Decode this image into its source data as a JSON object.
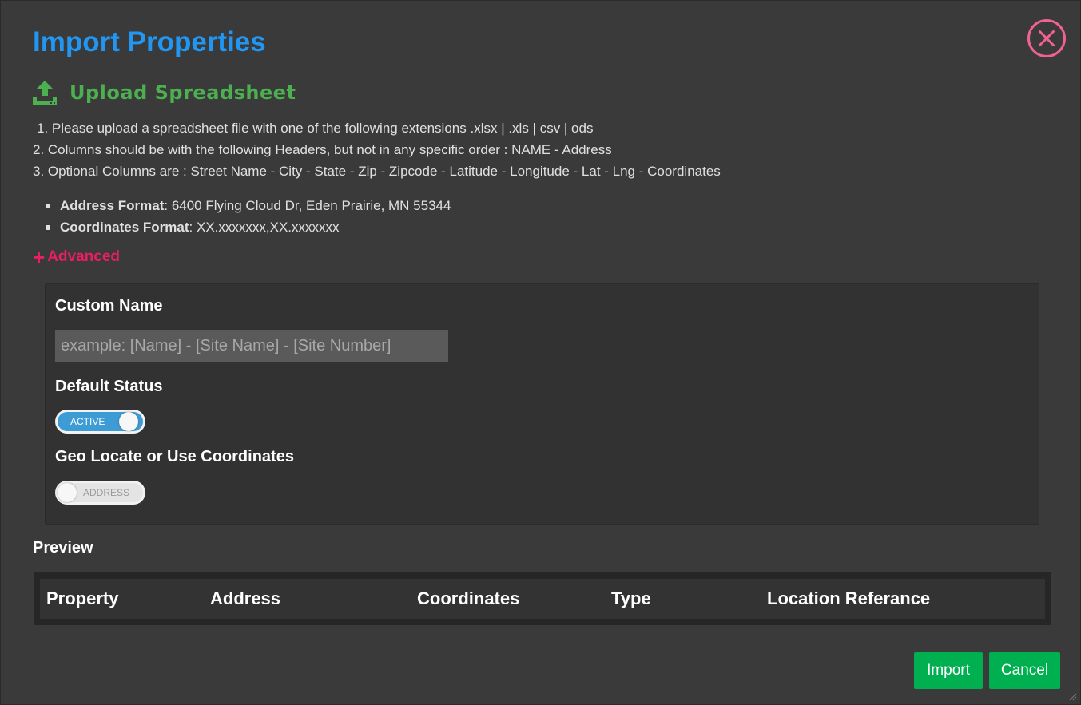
{
  "modal": {
    "title": "Import Properties"
  },
  "upload": {
    "label": "Upload Spreadsheet"
  },
  "instructions": [
    "1. Please upload a spreadsheet file with one of the following extensions .xlsx | .xls | csv | ods",
    "2. Columns should be with the following Headers, but not in any specific order : NAME - Address",
    "3. Optional Columns are : Street Name - City - State - Zip - Zipcode - Latitude - Longitude - Lat - Lng - Coordinates"
  ],
  "formats": [
    {
      "key": "Address Format",
      "value": ": 6400 Flying Cloud Dr, Eden Prairie, MN 55344"
    },
    {
      "key": "Coordinates Format",
      "value": ": XX.xxxxxxx,XX.xxxxxxx"
    }
  ],
  "advanced": {
    "plus": "+",
    "label": "Advanced",
    "custom_name_label": "Custom Name",
    "custom_name_placeholder": "example: [Name] - [Site Name] - [Site Number]",
    "custom_name_value": "",
    "default_status_label": "Default Status",
    "default_status_toggle": "ACTIVE",
    "default_status_on": true,
    "geo_label": "Geo Locate or Use Coordinates",
    "geo_toggle": "ADDRESS",
    "geo_on": false
  },
  "preview": {
    "label": "Preview",
    "columns": [
      "Property",
      "Address",
      "Coordinates",
      "Type",
      "Location Referance"
    ]
  },
  "buttons": {
    "import": "Import",
    "cancel": "Cancel"
  },
  "colors": {
    "title": "#2196f3",
    "upload": "#4caf50",
    "advanced": "#e91e63",
    "close": "#f06292",
    "toggle_on": "#3d9bd6",
    "button": "#00b050",
    "background": "#3a3a3a"
  },
  "icons": {
    "close": "close-circle-icon",
    "upload": "upload-icon",
    "resize": "resize-grip-icon"
  }
}
